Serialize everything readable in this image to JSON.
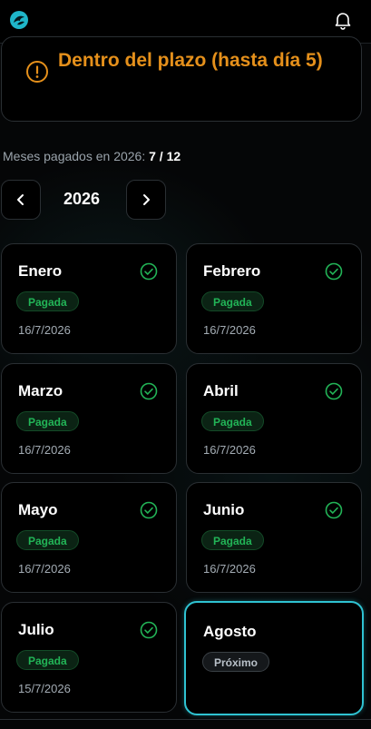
{
  "status": {
    "text": "Dentro del plazo (hasta día 5)",
    "color": "#e5901b"
  },
  "summary": {
    "label": "Meses pagados en 2026:",
    "value": "7 / 12"
  },
  "year_nav": {
    "prev_icon": "chevron-left-icon",
    "year": "2026",
    "next_icon": "chevron-right-icon"
  },
  "months": [
    {
      "name": "Enero",
      "status": "Pagada",
      "date": "16/7/2026"
    },
    {
      "name": "Febrero",
      "status": "Pagada",
      "date": "16/7/2026"
    },
    {
      "name": "Marzo",
      "status": "Pagada",
      "date": "16/7/2026"
    },
    {
      "name": "Abril",
      "status": "Pagada",
      "date": "16/7/2026"
    },
    {
      "name": "Mayo",
      "status": "Pagada",
      "date": "16/7/2026"
    },
    {
      "name": "Junio",
      "status": "Pagada",
      "date": "16/7/2026"
    },
    {
      "name": "Julio",
      "status": "Pagada",
      "date": "15/7/2026"
    },
    {
      "name": "Agosto",
      "status": "Próximo",
      "date": ""
    }
  ],
  "colors": {
    "paid_green": "#22b457",
    "accent_cyan": "#2fc3d2"
  }
}
